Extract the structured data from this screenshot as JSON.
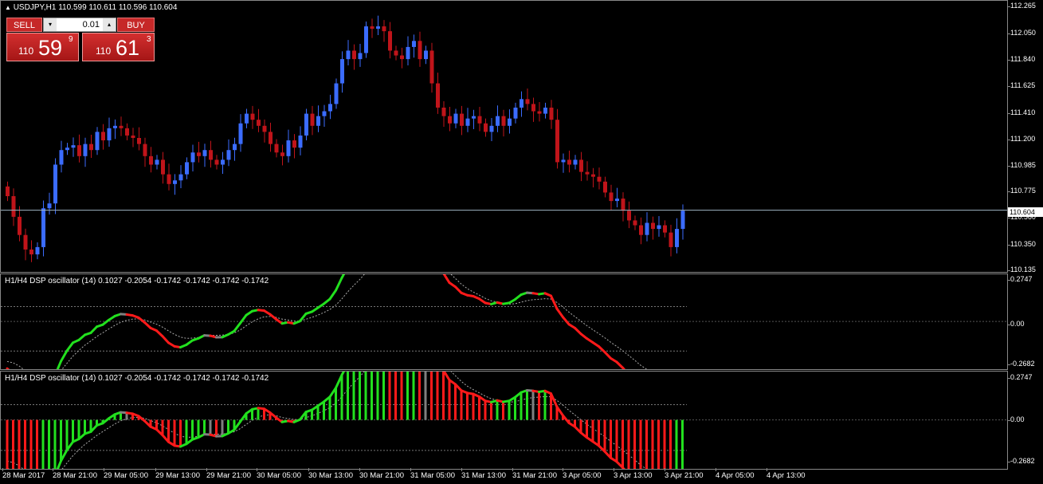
{
  "colors": {
    "bull": "#3b6cff",
    "bear": "#c0141a",
    "osc_up": "#22e01e",
    "osc_down": "#ff1a1a",
    "osc_neutral": "#808080",
    "bid_line": "#9fb4c4"
  },
  "header": {
    "symbol_tf": "USDJPY,H1",
    "ohlc": "110.599 110.611 110.596 110.604"
  },
  "trading_panel": {
    "sell_label": "SELL",
    "buy_label": "BUY",
    "lot_value": "0.01",
    "down_arrow": "▾",
    "up_arrow": "▴",
    "sell_small": "110",
    "sell_big": "59",
    "sell_sup": "9",
    "buy_small": "110",
    "buy_big": "61",
    "buy_sup": "3"
  },
  "price_scale": [
    "112.265",
    "112.050",
    "111.840",
    "111.625",
    "111.410",
    "111.200",
    "110.985",
    "110.775",
    "110.560",
    "110.350",
    "110.135"
  ],
  "current_price": "110.604",
  "indicator1": {
    "title": "H1/H4 DSP oscillator (14) 0.1027 -0.2054 -0.1742 -0.1742 -0.1742 -0.1742",
    "scale": [
      "0.2747",
      "0.00",
      "-0.2682"
    ]
  },
  "indicator2": {
    "title": "H1/H4 DSP oscillator (14) 0.1027 -0.2054 -0.1742 -0.1742 -0.1742 -0.1742",
    "scale": [
      "0.2747",
      "0.00",
      "-0.2682"
    ]
  },
  "time_axis": [
    "28 Mar 2017",
    "28 Mar 21:00",
    "29 Mar 05:00",
    "29 Mar 13:00",
    "29 Mar 21:00",
    "30 Mar 05:00",
    "30 Mar 13:00",
    "30 Mar 21:00",
    "31 Mar 05:00",
    "31 Mar 13:00",
    "31 Mar 21:00",
    "3 Apr 05:00",
    "3 Apr 13:00",
    "3 Apr 21:00",
    "4 Apr 05:00",
    "4 Apr 13:00"
  ],
  "chart_data": {
    "type": "candlestick",
    "symbol": "USDJPY",
    "timeframe": "H1",
    "ylim": [
      110.135,
      112.265
    ],
    "closes": [
      110.72,
      110.55,
      110.4,
      110.28,
      110.24,
      110.3,
      110.62,
      110.66,
      110.98,
      111.1,
      111.12,
      111.14,
      111.05,
      111.15,
      111.1,
      111.25,
      111.18,
      111.28,
      111.3,
      111.28,
      111.22,
      111.2,
      111.15,
      111.05,
      110.98,
      111.02,
      110.9,
      110.82,
      110.85,
      110.9,
      111.0,
      111.08,
      111.05,
      111.1,
      111.02,
      110.98,
      111.02,
      111.1,
      111.15,
      111.32,
      111.4,
      111.35,
      111.3,
      111.25,
      111.15,
      111.08,
      111.05,
      111.18,
      111.12,
      111.22,
      111.4,
      111.3,
      111.38,
      111.42,
      111.48,
      111.65,
      111.85,
      111.92,
      111.85,
      111.9,
      112.12,
      112.1,
      112.12,
      112.08,
      111.92,
      111.88,
      111.85,
      111.95,
      112.0,
      111.85,
      111.92,
      111.65,
      111.45,
      111.38,
      111.32,
      111.4,
      111.3,
      111.36,
      111.38,
      111.32,
      111.25,
      111.3,
      111.38,
      111.3,
      111.36,
      111.45,
      111.52,
      111.48,
      111.42,
      111.4,
      111.45,
      111.35,
      111.0,
      111.02,
      110.98,
      111.02,
      110.92,
      110.9,
      110.88,
      110.84,
      110.75,
      110.68,
      110.7,
      110.6,
      110.52,
      110.48,
      110.4,
      110.5,
      110.45,
      110.48,
      110.42,
      110.3,
      110.45,
      110.6
    ],
    "indicator_range": [
      -0.2682,
      0.2747
    ],
    "indicator_levels": [
      0.1,
      -0.2
    ]
  }
}
